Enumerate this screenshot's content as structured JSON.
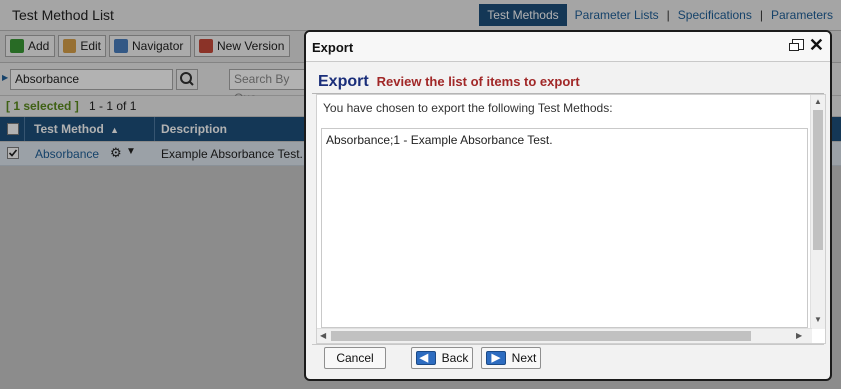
{
  "page": {
    "title": "Test Method List",
    "nav": [
      "Test Methods",
      "Parameter Lists",
      "Specifications",
      "Parameters"
    ],
    "nav_separator": "|"
  },
  "toolbar": {
    "add": "Add",
    "edit": "Edit",
    "navigator": "Navigator",
    "new_version": "New Version"
  },
  "search": {
    "value": "Absorbance",
    "query_placeholder": "Search By Que"
  },
  "selection": {
    "selected_text": "[ 1 selected ]",
    "range_text": "1 - 1 of 1"
  },
  "table": {
    "headers": [
      "Test Method",
      "Description"
    ],
    "rows": [
      {
        "name": "Absorbance",
        "description": "Example Absorbance Test."
      }
    ]
  },
  "dialog": {
    "title": "Export",
    "heading": "Export",
    "subheading": "Review the list of items to export",
    "message": "You have chosen to export the following Test Methods:",
    "items_text": "Absorbance;1 - Example Absorbance Test.",
    "buttons": {
      "cancel": "Cancel",
      "back": "Back",
      "next": "Next"
    }
  },
  "colors": {
    "accent": "#1d4f7c",
    "link": "#1f5f98",
    "heading": "#1a2e7a",
    "subheading": "#a12828",
    "selected": "#5b8c1e"
  }
}
